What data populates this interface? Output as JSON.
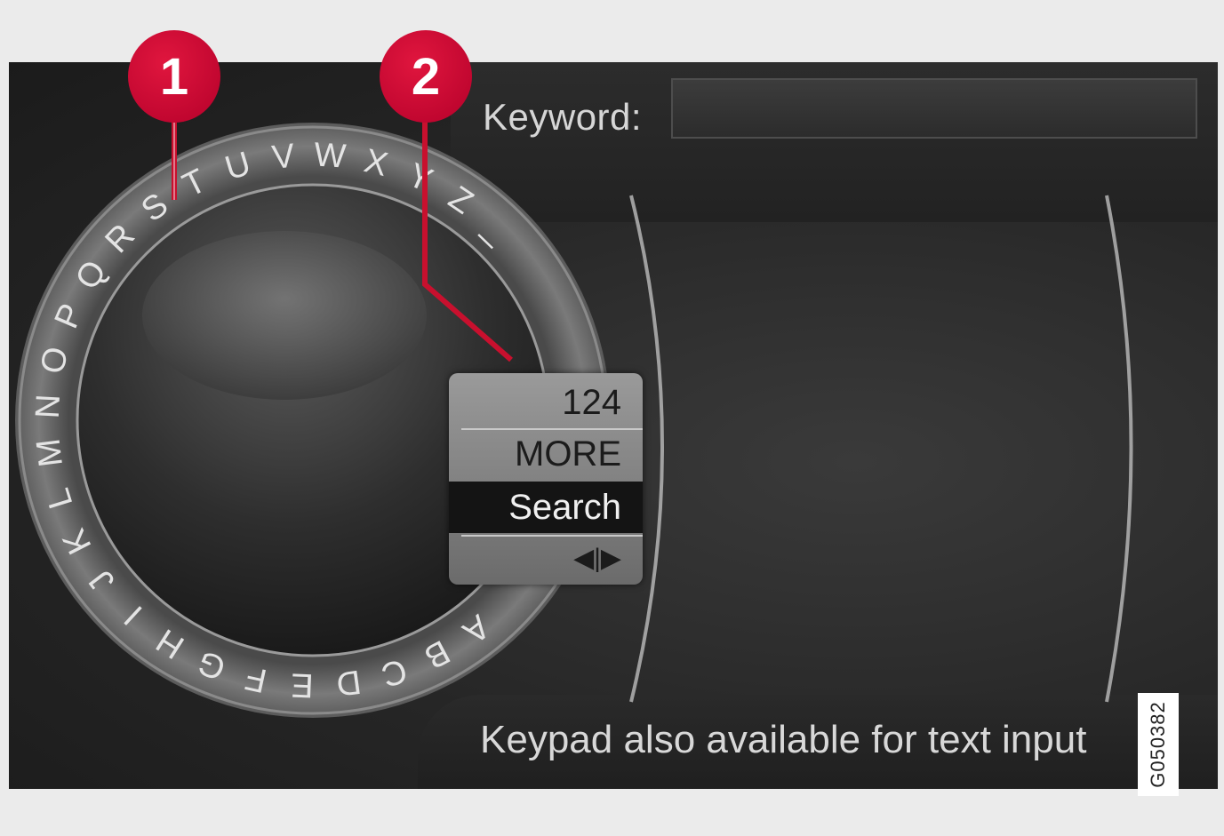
{
  "keyword": {
    "label": "Keyword:",
    "value": ""
  },
  "wheel": {
    "letters": [
      "A",
      "B",
      "C",
      "D",
      "E",
      "F",
      "G",
      "H",
      "I",
      "J",
      "K",
      "L",
      "M",
      "N",
      "O",
      "P",
      "Q",
      "R",
      "S",
      "T",
      "U",
      "V",
      "W",
      "X",
      "Y",
      "Z",
      "_"
    ]
  },
  "popup": {
    "items": [
      "124",
      "MORE",
      "Search"
    ],
    "selected": "Search",
    "arrows": "◀|▶"
  },
  "hint": "Keypad also available for text input",
  "callouts": [
    "1",
    "2"
  ],
  "figure_code": "G050382",
  "colors": {
    "callout": "#c8102e",
    "screen_bg": "#262626",
    "wheel_ring": "#6e6e6e",
    "popup_bg": "#8a8a8a",
    "selected_bg": "#141414"
  }
}
